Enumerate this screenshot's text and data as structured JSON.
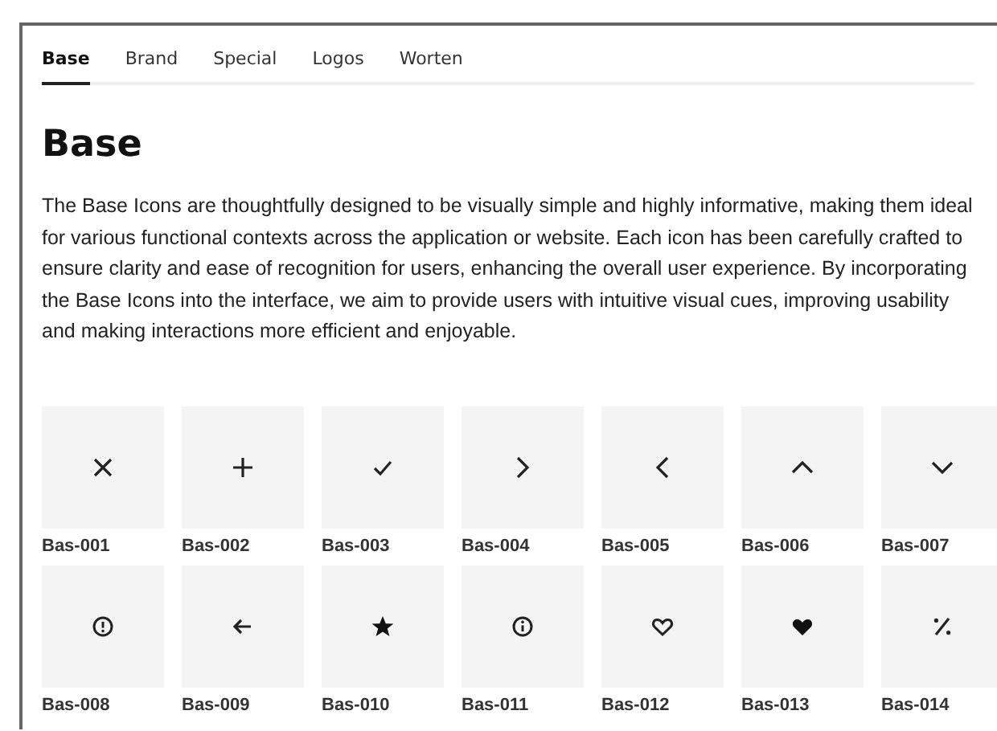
{
  "tabs": [
    {
      "label": "Base",
      "selected": true
    },
    {
      "label": "Brand",
      "selected": false
    },
    {
      "label": "Special",
      "selected": false
    },
    {
      "label": "Logos",
      "selected": false
    },
    {
      "label": "Worten",
      "selected": false
    }
  ],
  "heading": "Base",
  "description": "The Base Icons are thoughtfully designed to be visually simple and highly informative, making them ideal for various functional contexts across the application or website. Each icon has been carefully crafted to ensure clarity and ease of recognition for users, enhancing the overall user experience. By incorporating the Base Icons into the interface, we aim to provide users with intuitive visual cues, improving usability and making interactions more efficient and enjoyable.",
  "icons": [
    {
      "code": "Bas-001",
      "kind": "close"
    },
    {
      "code": "Bas-002",
      "kind": "plus"
    },
    {
      "code": "Bas-003",
      "kind": "check"
    },
    {
      "code": "Bas-004",
      "kind": "chevron-right"
    },
    {
      "code": "Bas-005",
      "kind": "chevron-left"
    },
    {
      "code": "Bas-006",
      "kind": "chevron-up"
    },
    {
      "code": "Bas-007",
      "kind": "chevron-down"
    },
    {
      "code": "Bas-008",
      "kind": "alert"
    },
    {
      "code": "Bas-009",
      "kind": "arrow-left"
    },
    {
      "code": "Bas-010",
      "kind": "star"
    },
    {
      "code": "Bas-011",
      "kind": "info"
    },
    {
      "code": "Bas-012",
      "kind": "heart-outline"
    },
    {
      "code": "Bas-013",
      "kind": "heart"
    },
    {
      "code": "Bas-014",
      "kind": "percent"
    }
  ]
}
